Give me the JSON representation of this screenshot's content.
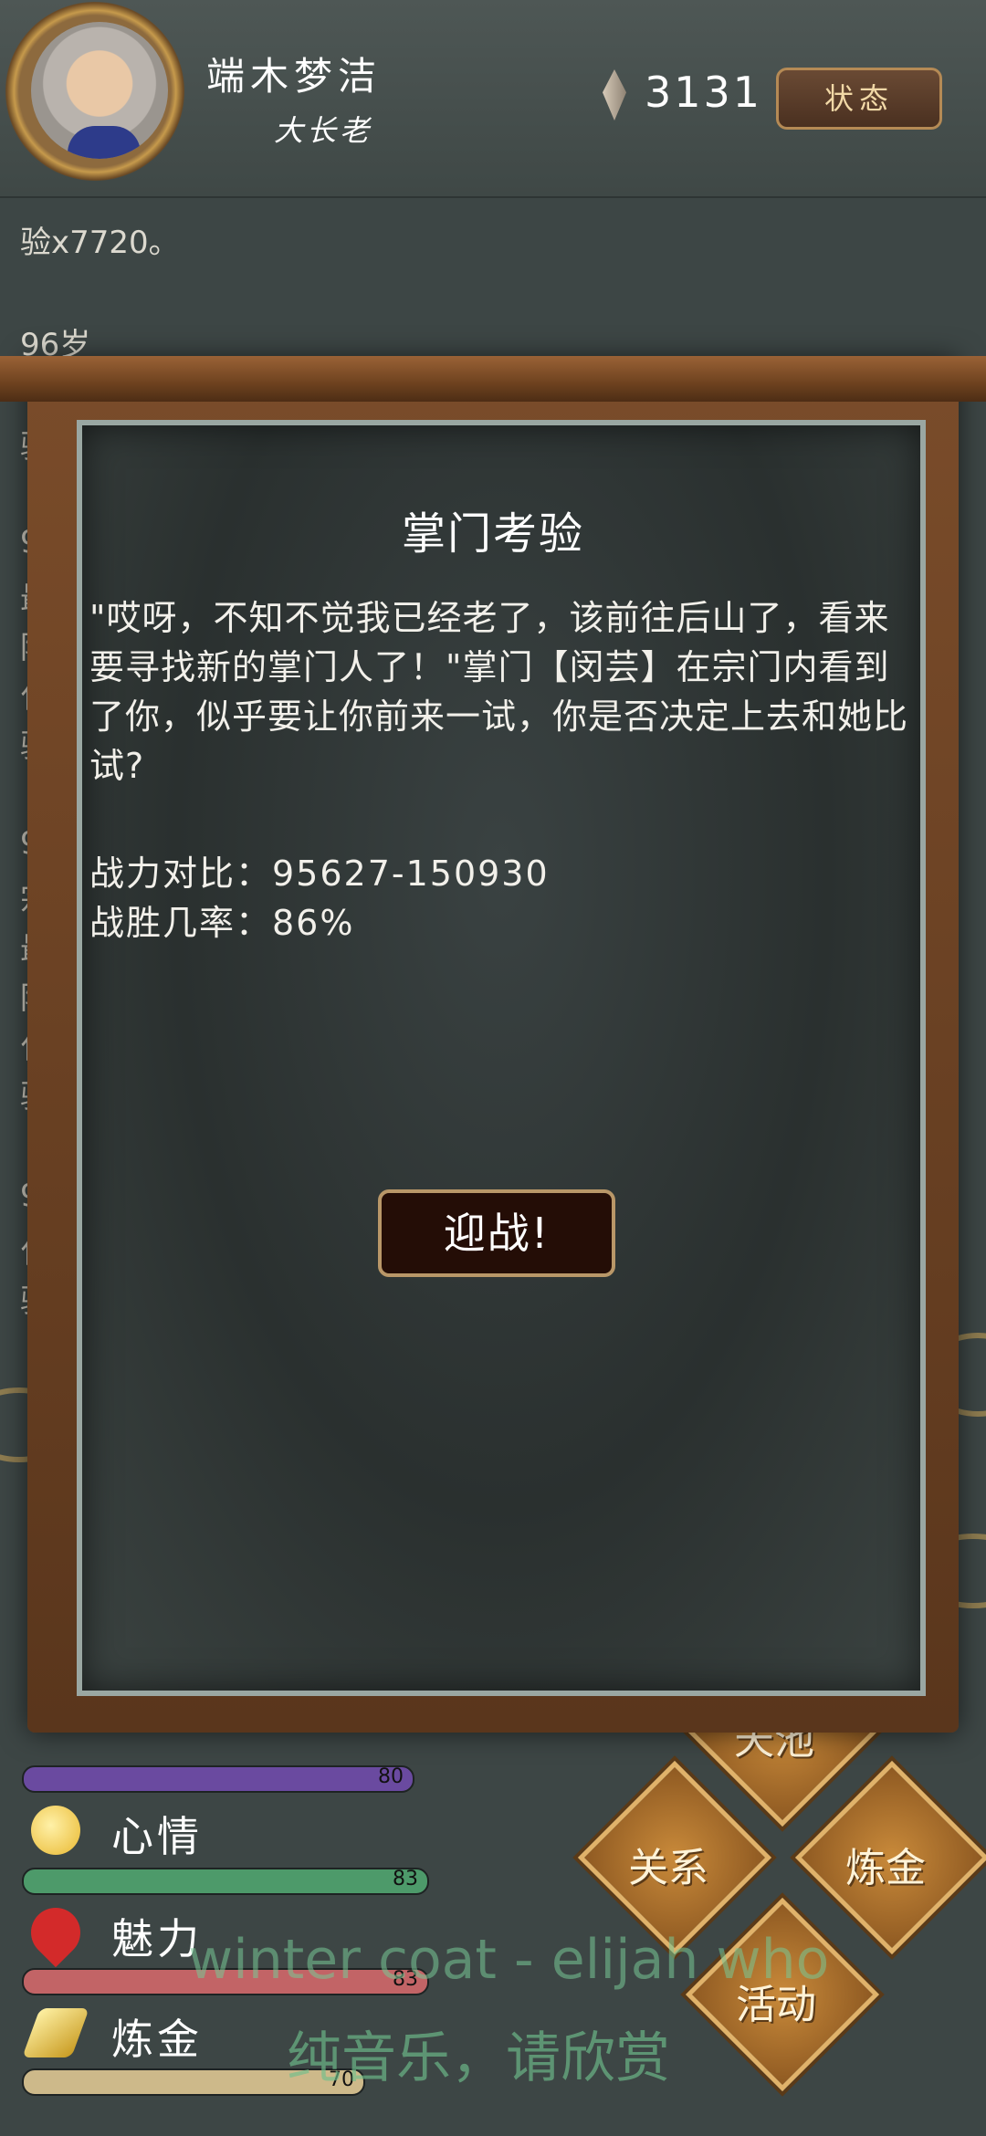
{
  "header": {
    "name": "端木梦洁",
    "title": "大长老",
    "gem_count": "3131",
    "status_button": "状态"
  },
  "log": {
    "line1": "验x7720。",
    "line2": "96岁",
    "fragments": [
      "驴",
      "9",
      "最",
      "阶",
      "化",
      "驴",
      "9",
      "宗",
      "最",
      "阶",
      "化",
      "驴",
      "9",
      "化",
      "驴"
    ]
  },
  "modal": {
    "title": "掌门考验",
    "body": "\"哎呀，不知不觉我已经老了，该前往后山了，看来要寻找新的掌门人了！\"掌门【闵芸】在宗门内看到了你，似乎要让你前来一试，你是否决定上去和她比试?",
    "power_compare": "战力对比：95627-150930",
    "win_rate": "战胜几率：86%",
    "fight_button": "迎战!"
  },
  "stats": [
    {
      "label": "",
      "value": 80,
      "max": 100,
      "color": "#6a4aa0"
    },
    {
      "label": "心情",
      "value": 83,
      "max": 100,
      "color": "#4d9a6a",
      "icon": "smile-icon"
    },
    {
      "label": "魅力",
      "value": 83,
      "max": 100,
      "color": "#c26466",
      "icon": "heart-icon"
    },
    {
      "label": "炼金",
      "value": 70,
      "max": 100,
      "color": "#cdb98a",
      "icon": "gold-ingot-icon"
    }
  ],
  "actions": [
    {
      "label": "天池"
    },
    {
      "label": "关系"
    },
    {
      "label": "炼金"
    },
    {
      "label": "活动"
    }
  ],
  "overlay": {
    "song": "winter coat - elijah who",
    "caption": "纯音乐，请欣赏"
  }
}
